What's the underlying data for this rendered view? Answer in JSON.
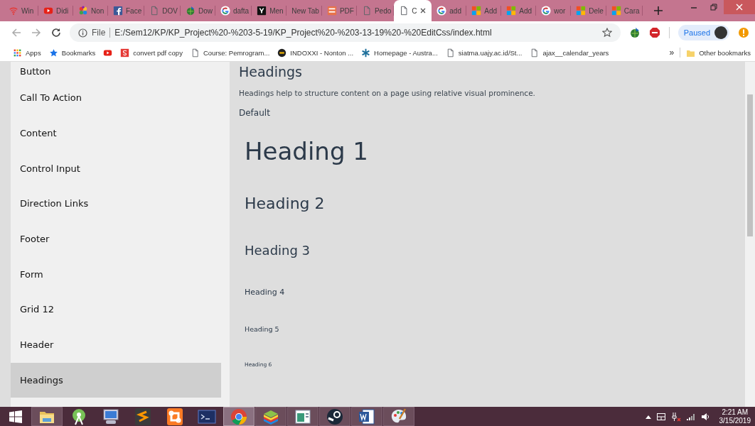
{
  "tabs": [
    {
      "label": "Win",
      "kind": "wifi",
      "selected": false
    },
    {
      "label": "Didi",
      "kind": "play",
      "selected": false
    },
    {
      "label": "Non",
      "kind": "pinwheel",
      "selected": false
    },
    {
      "label": "Face",
      "kind": "f",
      "selected": false
    },
    {
      "label": "DOV",
      "kind": "page",
      "selected": false
    },
    {
      "label": "Dow",
      "kind": "globe",
      "selected": false
    },
    {
      "label": "dafta",
      "kind": "g",
      "selected": false
    },
    {
      "label": "Men",
      "kind": "y",
      "selected": false
    },
    {
      "label": "New Tab",
      "kind": "blank",
      "selected": false
    },
    {
      "label": "PDF",
      "kind": "pdf",
      "selected": false
    },
    {
      "label": "Pedo",
      "kind": "page",
      "selected": false
    },
    {
      "label": "C",
      "kind": "page",
      "selected": true
    },
    {
      "label": "add",
      "kind": "g",
      "selected": false
    },
    {
      "label": "Add",
      "kind": "squares",
      "selected": false
    },
    {
      "label": "Add",
      "kind": "squares",
      "selected": false
    },
    {
      "label": "wor",
      "kind": "g",
      "selected": false
    },
    {
      "label": "Dele",
      "kind": "squares",
      "selected": false
    },
    {
      "label": "Cara",
      "kind": "squares",
      "selected": false
    }
  ],
  "address_bar": {
    "scheme": "File",
    "url": "E:/Sem12/KP/KP_Project%20-%203-5-19/KP_Project%20-%203-13-19%20-%20EditCss/index.html"
  },
  "profile": {
    "label": "Paused"
  },
  "bookmarks": [
    {
      "label": "Apps",
      "kind": "apps"
    },
    {
      "label": "Bookmarks",
      "kind": "star"
    },
    {
      "kind": "play"
    },
    {
      "label": "convert pdf copy",
      "kind": "s"
    },
    {
      "label": "Course: Pemrogram...",
      "kind": "page"
    },
    {
      "label": "INDOXXI - Nonton ...",
      "kind": "badge"
    },
    {
      "label": "Homepage - Austra...",
      "kind": "asterisk"
    },
    {
      "label": "siatma.uajy.ac.id/St...",
      "kind": "page"
    },
    {
      "label": "ajax__calendar_years",
      "kind": "page"
    }
  ],
  "overflow": "»",
  "other_bookmarks": "Other bookmarks",
  "sidebar": {
    "items": [
      {
        "label": "Button",
        "selected": false
      },
      {
        "label": "Call To Action",
        "selected": false
      },
      {
        "label": "Content",
        "selected": false
      },
      {
        "label": "Control Input",
        "selected": false
      },
      {
        "label": "Direction Links",
        "selected": false
      },
      {
        "label": "Footer",
        "selected": false
      },
      {
        "label": "Form",
        "selected": false
      },
      {
        "label": "Grid 12",
        "selected": false
      },
      {
        "label": "Header",
        "selected": false
      },
      {
        "label": "Headings",
        "selected": true
      }
    ]
  },
  "content": {
    "title": "Headings",
    "description": "Headings help to structure content on a page using relative visual prominence.",
    "variant": "Default",
    "headings": [
      "Heading 1",
      "Heading 2",
      "Heading 3",
      "Heading 4",
      "Heading 5",
      "Heading 6"
    ]
  },
  "taskbar": {
    "apps": [
      {
        "kind": "folder",
        "running": true,
        "selected": false
      },
      {
        "kind": "robot",
        "running": false,
        "selected": false
      },
      {
        "kind": "monitor",
        "running": false,
        "selected": false
      },
      {
        "kind": "stile",
        "running": false,
        "selected": false
      },
      {
        "kind": "knot",
        "running": false,
        "selected": false
      },
      {
        "kind": "terminal",
        "running": false,
        "selected": false
      },
      {
        "kind": "chrome",
        "running": true,
        "selected": true
      },
      {
        "kind": "layers",
        "running": true,
        "selected": false
      },
      {
        "kind": "window",
        "running": true,
        "selected": false
      },
      {
        "kind": "piston",
        "running": true,
        "selected": false
      },
      {
        "kind": "word",
        "running": true,
        "selected": false
      },
      {
        "kind": "palette",
        "running": true,
        "selected": false
      }
    ],
    "clock": {
      "time": "2:21 AM",
      "date": "3/15/2019"
    }
  }
}
